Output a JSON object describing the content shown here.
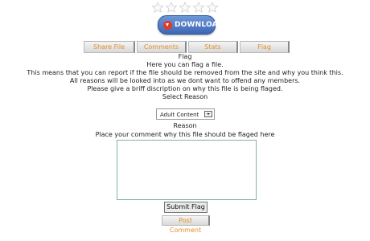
{
  "rating": {
    "stars": 5,
    "filled": 0,
    "icon": "star-outline-icon"
  },
  "download": {
    "label": "DOWNLOAD",
    "icon": "download-arrow-icon",
    "color": "#3d67b5"
  },
  "tabs": [
    {
      "label": "Share File"
    },
    {
      "label": "Comments"
    },
    {
      "label": "Stats"
    },
    {
      "label": "Flag"
    }
  ],
  "flag": {
    "heading": "Flag",
    "lines": [
      "Here you can flag a file.",
      "This means that you can report if the file should be removed from the site and why you think this.",
      "All reasons will be looked into as we dont want to offend any members.",
      "Please give a briff discription on why this file is being flaged."
    ],
    "select_reason_label": "Select Reason",
    "select_value": "Adult Content",
    "reason_label": "Reason",
    "comment_label": "Place your comment why this file should be flaged here",
    "comment_value": "",
    "submit_label": "Submit Flag",
    "post_comment_label": "Post Comment"
  },
  "colors": {
    "tab_text": "#e0902c",
    "textarea_border": "#7fb89a"
  }
}
